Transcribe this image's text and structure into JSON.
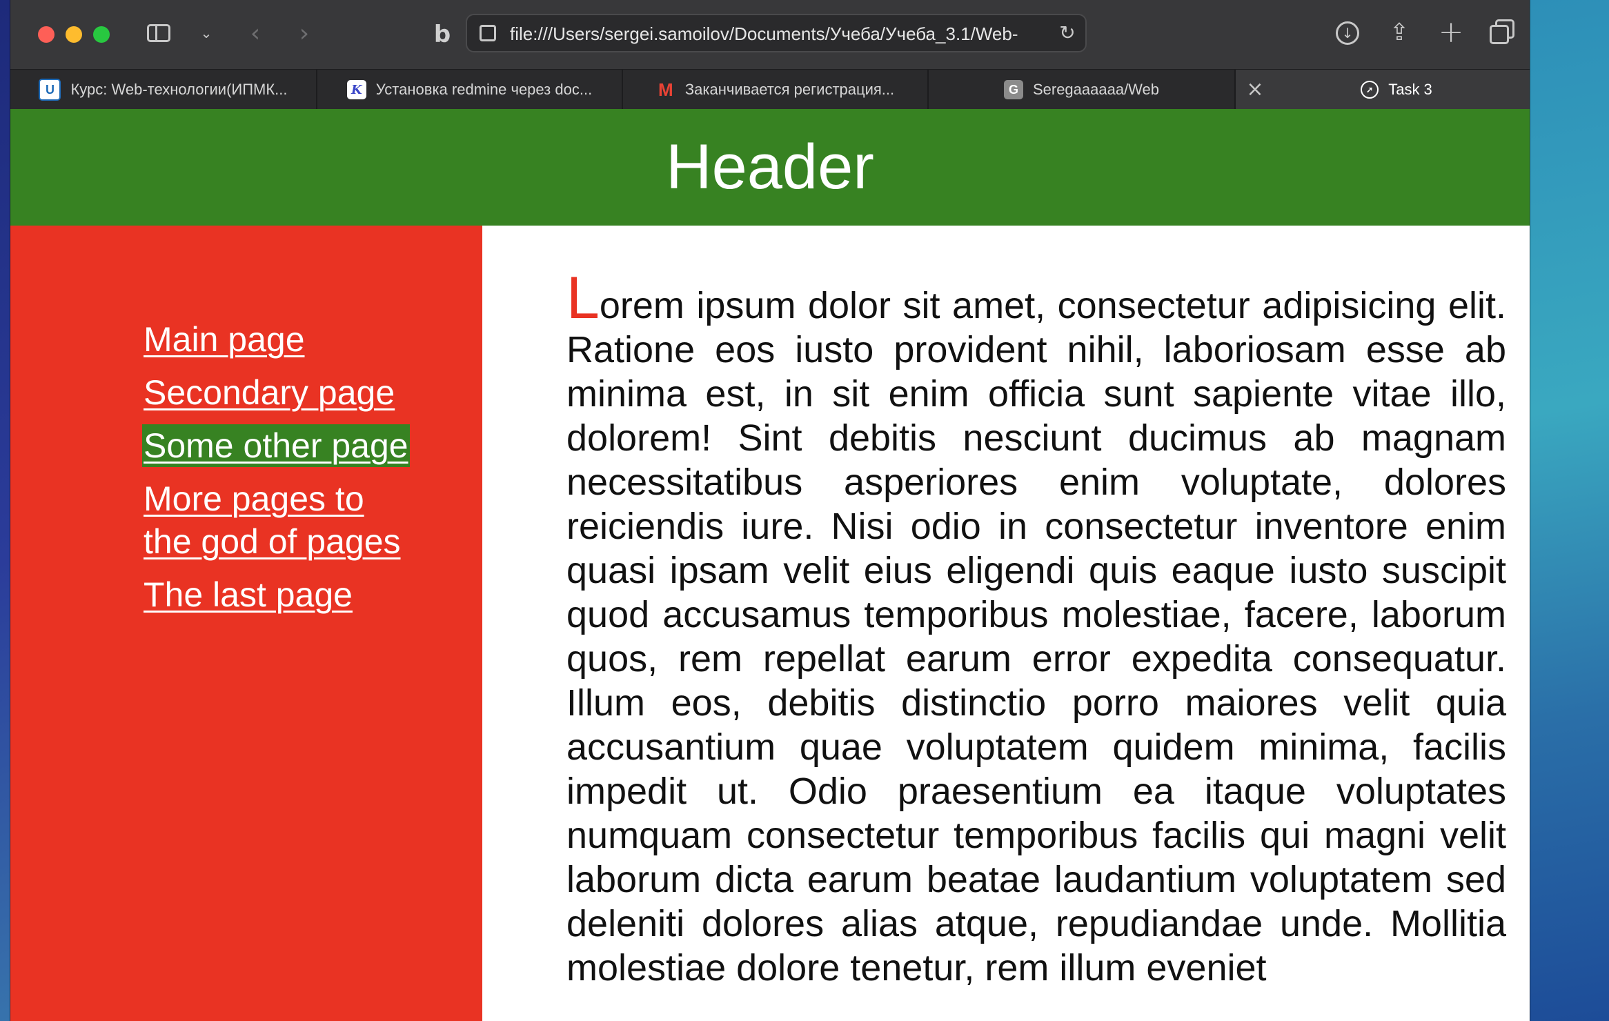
{
  "browser": {
    "address": "file:///Users/sergei.samoilov/Documents/Учеба/Учеба_3.1/Web-",
    "tabs": [
      {
        "label": "Курс: Web-технологии(ИПМК...",
        "icon": "u-icon",
        "icon_color": "#1e6bb8"
      },
      {
        "label": "Установка redmine через doc...",
        "icon": "k-icon",
        "icon_color": "#ffffff"
      },
      {
        "label": "Заканчивается регистрация...",
        "icon": "gmail-icon",
        "icon_color": "#ea4335"
      },
      {
        "label": "Seregaaaaaa/Web",
        "icon": "github-icon",
        "icon_color": "#8b8b8b"
      },
      {
        "label": "Task 3",
        "icon": "compass-icon",
        "active": true
      }
    ]
  },
  "page": {
    "header": "Header",
    "nav": [
      {
        "label": "Main page"
      },
      {
        "label": "Secondary page"
      },
      {
        "label": "Some other page",
        "active": true
      },
      {
        "label_line1": "More pages to",
        "label_line2": "the god of pages"
      },
      {
        "label": "The last page"
      }
    ],
    "content": {
      "first_letter": "L",
      "text": "orem ipsum dolor sit amet, consectetur adipisicing elit. Ratione eos iusto provident nihil, laboriosam esse ab minima est, in sit enim officia sunt sapiente vitae illo, dolorem! Sint debitis nesciunt ducimus ab magnam necessitatibus asperiores enim voluptate, dolores reiciendis iure. Nisi odio in consectetur inventore enim quasi ipsam velit eius eligendi quis eaque iusto suscipit quod accusamus temporibus molestiae, facere, laborum quos, rem repellat earum error expedita consequatur. Illum eos, debitis distinctio porro maiores velit quia accusantium quae voluptatem quidem minima, facilis impedit ut. Odio praesentium ea itaque voluptates numquam consectetur temporibus facilis qui magni velit laborum dicta earum beatae laudantium voluptatem sed deleniti dolores alias atque, repudiandae unde. Mollitia molestiae dolore tenetur, rem illum eveniet"
    }
  },
  "colors": {
    "header_bg": "#378222",
    "nav_bg": "#e93323",
    "active_link_bg": "#378222",
    "first_letter": "#e93323"
  }
}
